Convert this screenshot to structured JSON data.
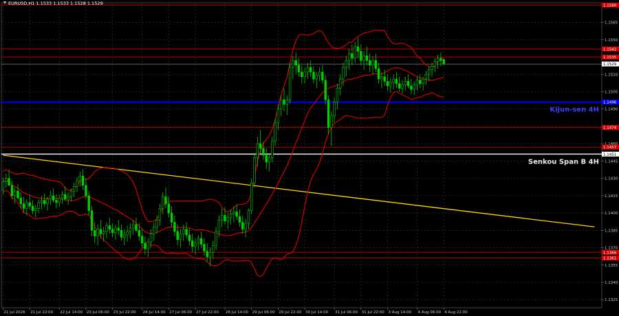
{
  "chart_data": {
    "type": "candlestick",
    "title": "EURUSD,H1  1.1533 1.1533 1.1528 1.1529",
    "ylim": [
      1.1318,
      1.1582
    ],
    "y_ticks": [
      "1.1565",
      "1.1550",
      "1.1535",
      "1.1520",
      "1.1505",
      "1.1490",
      "1.1475",
      "1.1460",
      "1.1445",
      "1.1430",
      "1.1415",
      "1.1400",
      "1.1385",
      "1.1370",
      "1.1355",
      "1.1340",
      "1.1325"
    ],
    "x_ticks": [
      "21 Jul 2026",
      "21 Jul 22:00",
      "22 Jul 14:00",
      "23 Jul 06:00",
      "23 Jul 22:00",
      "24 Jul 14:00",
      "27 Jul 06:00",
      "27 Jul 22:00",
      "28 Jul 14:00",
      "29 Jul 06:00",
      "29 Jul 22:00",
      "30 Jul 14:00",
      "31 Jul 06:00",
      "31 Jul 22:00",
      "3 Aug 14:00",
      "4 Aug 06:00",
      "4 Aug 22:00"
    ],
    "current_price": "1.1529",
    "horizontal_levels": [
      {
        "name": "",
        "value": 1.158,
        "label": "1.1580",
        "color": "#b40000"
      },
      {
        "name": "",
        "value": 1.1542,
        "label": "1.1542",
        "color": "#b40000"
      },
      {
        "name": "",
        "value": 1.1535,
        "label": "1.1535",
        "color": "#b40000"
      },
      {
        "name": "Kijun-sen 4H",
        "value": 1.1496,
        "label": "1.1496",
        "color": "#0000ff",
        "text": "Kijun-sen 4H"
      },
      {
        "name": "",
        "value": 1.1474,
        "label": "1.1474",
        "color": "#b40000"
      },
      {
        "name": "",
        "value": 1.1457,
        "label": "1.1457",
        "color": "#b40000"
      },
      {
        "name": "Senkou Span B 4H",
        "value": 1.1451,
        "label": "1.1451",
        "color": "#dddddd",
        "text": "Senkou Span B 4H"
      },
      {
        "name": "",
        "value": 1.1366,
        "label": "1.1366",
        "color": "#b40000"
      },
      {
        "name": "",
        "value": 1.1361,
        "label": "1.1361",
        "color": "#b40000"
      }
    ],
    "trend_line": {
      "color": "#ffd700",
      "from": {
        "bar": 0,
        "price": 1.145
      },
      "to": {
        "bar": 200,
        "price": 1.1388
      }
    },
    "candles": [
      [
        1.142,
        1.1431,
        1.1416,
        1.1427
      ],
      [
        1.1427,
        1.1434,
        1.1422,
        1.143
      ],
      [
        1.143,
        1.1438,
        1.1425,
        1.1424
      ],
      [
        1.1424,
        1.1428,
        1.1412,
        1.1415
      ],
      [
        1.1415,
        1.1422,
        1.1408,
        1.1419
      ],
      [
        1.1419,
        1.1425,
        1.1411,
        1.1413
      ],
      [
        1.1413,
        1.1418,
        1.1404,
        1.1408
      ],
      [
        1.1408,
        1.1414,
        1.14,
        1.1404
      ],
      [
        1.1404,
        1.1412,
        1.1398,
        1.1409
      ],
      [
        1.1409,
        1.1416,
        1.1403,
        1.1406
      ],
      [
        1.1406,
        1.1411,
        1.1399,
        1.1402
      ],
      [
        1.1402,
        1.1407,
        1.1396,
        1.1404
      ],
      [
        1.1404,
        1.1412,
        1.14,
        1.1409
      ],
      [
        1.1409,
        1.1415,
        1.1403,
        1.1411
      ],
      [
        1.1411,
        1.1417,
        1.1405,
        1.1408
      ],
      [
        1.1408,
        1.1414,
        1.1402,
        1.1412
      ],
      [
        1.1412,
        1.1419,
        1.1407,
        1.1415
      ],
      [
        1.1415,
        1.1421,
        1.1409,
        1.1411
      ],
      [
        1.1411,
        1.1416,
        1.1404,
        1.1409
      ],
      [
        1.1409,
        1.1416,
        1.1405,
        1.1413
      ],
      [
        1.1413,
        1.1419,
        1.1408,
        1.1416
      ],
      [
        1.1416,
        1.1423,
        1.1411,
        1.1412
      ],
      [
        1.1412,
        1.1418,
        1.1407,
        1.1414
      ],
      [
        1.1414,
        1.1421,
        1.141,
        1.1419
      ],
      [
        1.1419,
        1.1426,
        1.1414,
        1.1423
      ],
      [
        1.1423,
        1.1431,
        1.1418,
        1.1428
      ],
      [
        1.1428,
        1.1436,
        1.1423,
        1.1432
      ],
      [
        1.1432,
        1.1438,
        1.142,
        1.1424
      ],
      [
        1.1424,
        1.143,
        1.1412,
        1.1415
      ],
      [
        1.1415,
        1.1419,
        1.1398,
        1.1402
      ],
      [
        1.1402,
        1.1406,
        1.138,
        1.1385
      ],
      [
        1.1385,
        1.1392,
        1.1374,
        1.138
      ],
      [
        1.138,
        1.139,
        1.1372,
        1.1386
      ],
      [
        1.1386,
        1.1394,
        1.1378,
        1.1382
      ],
      [
        1.1382,
        1.1388,
        1.1375,
        1.1384
      ],
      [
        1.1384,
        1.1392,
        1.1378,
        1.1389
      ],
      [
        1.1389,
        1.1396,
        1.1382,
        1.1386
      ],
      [
        1.1386,
        1.1391,
        1.1379,
        1.1383
      ],
      [
        1.1383,
        1.139,
        1.1377,
        1.1387
      ],
      [
        1.1387,
        1.1394,
        1.1381,
        1.1385
      ],
      [
        1.1385,
        1.139,
        1.1376,
        1.1379
      ],
      [
        1.1379,
        1.1386,
        1.1372,
        1.1381
      ],
      [
        1.1381,
        1.1389,
        1.1375,
        1.1384
      ],
      [
        1.1384,
        1.1391,
        1.1378,
        1.1387
      ],
      [
        1.1387,
        1.1394,
        1.1381,
        1.139
      ],
      [
        1.139,
        1.1396,
        1.1383,
        1.1385
      ],
      [
        1.1385,
        1.1391,
        1.1376,
        1.138
      ],
      [
        1.138,
        1.1386,
        1.137,
        1.1374
      ],
      [
        1.1374,
        1.138,
        1.1364,
        1.1369
      ],
      [
        1.1369,
        1.1378,
        1.1362,
        1.1375
      ],
      [
        1.1375,
        1.1386,
        1.137,
        1.1382
      ],
      [
        1.1382,
        1.1392,
        1.1376,
        1.1388
      ],
      [
        1.1388,
        1.1398,
        1.1382,
        1.1394
      ],
      [
        1.1394,
        1.1408,
        1.1389,
        1.1404
      ],
      [
        1.1404,
        1.1418,
        1.1399,
        1.1414
      ],
      [
        1.1414,
        1.1422,
        1.1404,
        1.1408
      ],
      [
        1.1408,
        1.1414,
        1.1396,
        1.14
      ],
      [
        1.14,
        1.1406,
        1.1388,
        1.1392
      ],
      [
        1.1392,
        1.1398,
        1.138,
        1.1384
      ],
      [
        1.1384,
        1.139,
        1.1372,
        1.1377
      ],
      [
        1.1377,
        1.1386,
        1.137,
        1.1382
      ],
      [
        1.1382,
        1.139,
        1.1376,
        1.1386
      ],
      [
        1.1386,
        1.1392,
        1.1378,
        1.1381
      ],
      [
        1.1381,
        1.1387,
        1.1372,
        1.1376
      ],
      [
        1.1376,
        1.1382,
        1.1366,
        1.1371
      ],
      [
        1.1371,
        1.1378,
        1.1364,
        1.1374
      ],
      [
        1.1374,
        1.1381,
        1.1368,
        1.1378
      ],
      [
        1.1378,
        1.1384,
        1.137,
        1.1373
      ],
      [
        1.1373,
        1.1378,
        1.1363,
        1.1367
      ],
      [
        1.1367,
        1.1374,
        1.1358,
        1.1362
      ],
      [
        1.1362,
        1.137,
        1.1354,
        1.1366
      ],
      [
        1.1366,
        1.1376,
        1.136,
        1.1372
      ],
      [
        1.1372,
        1.1388,
        1.1368,
        1.1384
      ],
      [
        1.1384,
        1.1398,
        1.1379,
        1.1394
      ],
      [
        1.1394,
        1.1404,
        1.1388,
        1.1398
      ],
      [
        1.1398,
        1.1405,
        1.139,
        1.1393
      ],
      [
        1.1393,
        1.14,
        1.1386,
        1.1396
      ],
      [
        1.1396,
        1.1403,
        1.139,
        1.1399
      ],
      [
        1.1399,
        1.1406,
        1.1392,
        1.1401
      ],
      [
        1.1401,
        1.1408,
        1.1394,
        1.1397
      ],
      [
        1.1397,
        1.1403,
        1.1388,
        1.1392
      ],
      [
        1.1392,
        1.1398,
        1.1382,
        1.1386
      ],
      [
        1.1386,
        1.1395,
        1.1379,
        1.1391
      ],
      [
        1.1391,
        1.1404,
        1.1386,
        1.1402
      ],
      [
        1.1402,
        1.143,
        1.1399,
        1.1426
      ],
      [
        1.1426,
        1.1452,
        1.1422,
        1.1448
      ],
      [
        1.1448,
        1.1466,
        1.144,
        1.146
      ],
      [
        1.146,
        1.1472,
        1.1452,
        1.1456
      ],
      [
        1.1456,
        1.1462,
        1.1446,
        1.145
      ],
      [
        1.145,
        1.1456,
        1.1438,
        1.1444
      ],
      [
        1.1444,
        1.1452,
        1.1436,
        1.1448
      ],
      [
        1.1448,
        1.1466,
        1.1444,
        1.1462
      ],
      [
        1.1462,
        1.1482,
        1.1458,
        1.1478
      ],
      [
        1.1478,
        1.1494,
        1.1472,
        1.149
      ],
      [
        1.149,
        1.1502,
        1.1484,
        1.1498
      ],
      [
        1.1498,
        1.1508,
        1.1488,
        1.1494
      ],
      [
        1.1494,
        1.1502,
        1.1485,
        1.1498
      ],
      [
        1.1498,
        1.153,
        1.1495,
        1.1526
      ],
      [
        1.1526,
        1.1536,
        1.1516,
        1.1532
      ],
      [
        1.1532,
        1.1539,
        1.152,
        1.1528
      ],
      [
        1.1528,
        1.1534,
        1.1518,
        1.1522
      ],
      [
        1.1522,
        1.1528,
        1.1512,
        1.1518
      ],
      [
        1.1518,
        1.1526,
        1.1512,
        1.1522
      ],
      [
        1.1522,
        1.153,
        1.1516,
        1.1526
      ],
      [
        1.1526,
        1.1532,
        1.1518,
        1.1522
      ],
      [
        1.1522,
        1.1527,
        1.1512,
        1.1516
      ],
      [
        1.1516,
        1.1522,
        1.1508,
        1.1519
      ],
      [
        1.1519,
        1.1526,
        1.1514,
        1.1522
      ],
      [
        1.1522,
        1.1528,
        1.1512,
        1.1515
      ],
      [
        1.1515,
        1.1519,
        1.1494,
        1.1498
      ],
      [
        1.1498,
        1.1502,
        1.1468,
        1.1474
      ],
      [
        1.1474,
        1.1488,
        1.1458,
        1.1484
      ],
      [
        1.1484,
        1.15,
        1.1478,
        1.1496
      ],
      [
        1.1496,
        1.1512,
        1.149,
        1.1508
      ],
      [
        1.1508,
        1.152,
        1.1502,
        1.1516
      ],
      [
        1.1516,
        1.153,
        1.151,
        1.1526
      ],
      [
        1.1526,
        1.1536,
        1.1518,
        1.1532
      ],
      [
        1.1532,
        1.1542,
        1.1524,
        1.1538
      ],
      [
        1.1538,
        1.1546,
        1.1528,
        1.1534
      ],
      [
        1.1534,
        1.1548,
        1.153,
        1.1544
      ],
      [
        1.1544,
        1.1552,
        1.1534,
        1.154
      ],
      [
        1.154,
        1.1546,
        1.1528,
        1.1532
      ],
      [
        1.1532,
        1.154,
        1.1524,
        1.1536
      ],
      [
        1.1536,
        1.1544,
        1.1528,
        1.1532
      ],
      [
        1.1532,
        1.1538,
        1.1522,
        1.1528
      ],
      [
        1.1528,
        1.1536,
        1.152,
        1.1532
      ],
      [
        1.1532,
        1.1538,
        1.1522,
        1.1525
      ],
      [
        1.1525,
        1.153,
        1.1512,
        1.1516
      ],
      [
        1.1516,
        1.1522,
        1.1508,
        1.1518
      ],
      [
        1.1518,
        1.1524,
        1.151,
        1.1514
      ],
      [
        1.1514,
        1.152,
        1.1506,
        1.151
      ],
      [
        1.151,
        1.1517,
        1.1504,
        1.1513
      ],
      [
        1.1513,
        1.152,
        1.1507,
        1.1516
      ],
      [
        1.1516,
        1.1522,
        1.1508,
        1.1512
      ],
      [
        1.1512,
        1.1518,
        1.1505,
        1.1508
      ],
      [
        1.1508,
        1.1515,
        1.1503,
        1.1511
      ],
      [
        1.1511,
        1.1518,
        1.1506,
        1.1514
      ],
      [
        1.1514,
        1.152,
        1.1508,
        1.151
      ],
      [
        1.151,
        1.1516,
        1.1503,
        1.1507
      ],
      [
        1.1507,
        1.1514,
        1.1502,
        1.1511
      ],
      [
        1.1511,
        1.1518,
        1.1506,
        1.1515
      ],
      [
        1.1515,
        1.152,
        1.1508,
        1.1512
      ],
      [
        1.1512,
        1.1518,
        1.1506,
        1.1516
      ],
      [
        1.1516,
        1.1523,
        1.1511,
        1.152
      ],
      [
        1.152,
        1.1527,
        1.1514,
        1.1524
      ],
      [
        1.1524,
        1.153,
        1.1518,
        1.1527
      ],
      [
        1.1527,
        1.1534,
        1.1522,
        1.1531
      ],
      [
        1.1531,
        1.1537,
        1.1525,
        1.1534
      ],
      [
        1.1534,
        1.1539,
        1.1527,
        1.1532
      ],
      [
        1.1533,
        1.1533,
        1.1528,
        1.1529
      ]
    ]
  }
}
